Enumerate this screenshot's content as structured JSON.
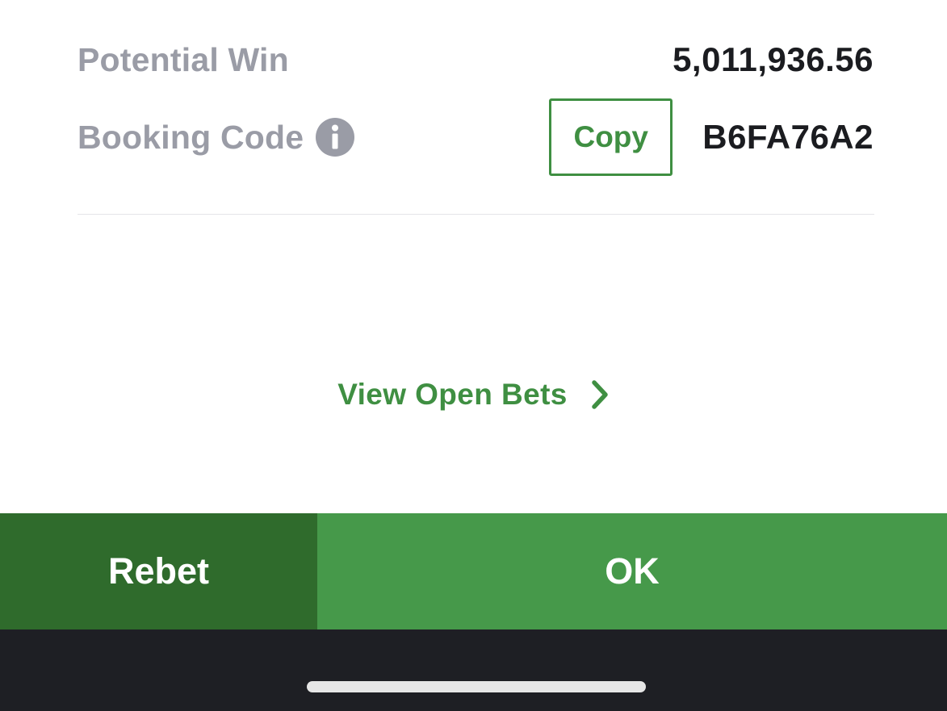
{
  "summary": {
    "potential_win_label": "Potential Win",
    "potential_win_value": "5,011,936.56",
    "booking_code_label": "Booking Code",
    "booking_code_value": "B6FA76A2",
    "copy_label": "Copy"
  },
  "links": {
    "view_open_bets": "View Open Bets"
  },
  "actions": {
    "rebet_label": "Rebet",
    "ok_label": "OK"
  },
  "icons": {
    "info": "info-icon",
    "chevron": "chevron-right-icon"
  },
  "colors": {
    "accent_green": "#3f8f42",
    "rebet_green": "#2f6b2c",
    "ok_green": "#46994a",
    "label_gray": "#9a9ca6",
    "value_dark": "#1b1c20",
    "home_bar_bg": "#1e1f24"
  }
}
